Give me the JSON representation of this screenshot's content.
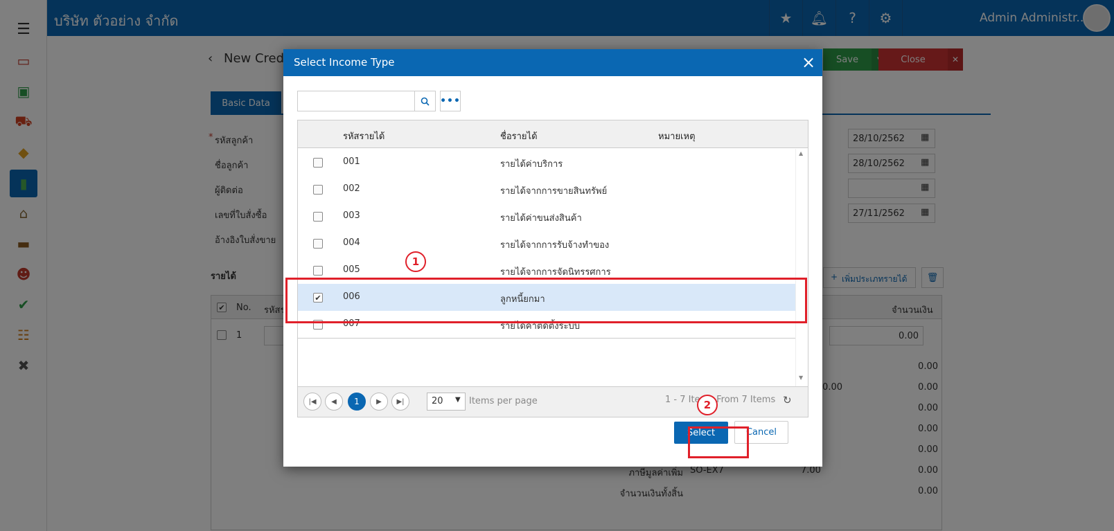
{
  "app": {
    "company_name": "บริษัท ตัวอย่าง จำกัด",
    "admin_name": "Admin Administr...",
    "page_title": "New Cred",
    "save_label": "Save",
    "close_label": "Close",
    "tab_basic": "Basic Data",
    "form_labels": [
      "รหัสลูกค้า",
      "ชื่อลูกค้า",
      "ผู้ติดต่อ",
      "เลขที่ใบสั่งซื้อ",
      "อ้างอิงใบสั่งขาย"
    ],
    "required_mark": "*",
    "dates": [
      "28/10/2562",
      "28/10/2562",
      "",
      "27/11/2562"
    ],
    "income_section": "รายได้",
    "add_income_type": "เพิ่มประเภทรายได้",
    "table_no": "No.",
    "table_code_short": "รหัสร",
    "table_amount": "จำนวนเงิน",
    "row_no": "1",
    "amounts": [
      "0.00",
      "0.00",
      "0.00",
      "0.00",
      "0.00",
      "0.00",
      "0.00"
    ],
    "partial_amount": "0.00",
    "vat_label": "ภาษีมูลค่าเพิ่ม",
    "vat_code": "SO-EX7",
    "vat_rate": "7.00",
    "vat_amount": "0.00",
    "grand_total_label": "จำนวนเงินทั้งสิ้น",
    "grand_total": "0.00"
  },
  "modal": {
    "title": "Select Income Type",
    "search_placeholder": "",
    "columns": {
      "code": "รหัสรายได้",
      "name": "ชื่อรายได้",
      "note": "หมายเหตุ"
    },
    "rows": [
      {
        "code": "001",
        "name": "รายได้ค่าบริการ",
        "checked": false
      },
      {
        "code": "002",
        "name": "รายได้จากการขายสินทรัพย์",
        "checked": false
      },
      {
        "code": "003",
        "name": "รายได้ค่าขนส่งสินค้า",
        "checked": false
      },
      {
        "code": "004",
        "name": "รายได้จากการรับจ้างทำของ",
        "checked": false
      },
      {
        "code": "005",
        "name": "รายได้จากการจัดนิทรรศการ",
        "checked": false
      },
      {
        "code": "006",
        "name": "ลูกหนี้ยกมา",
        "checked": true
      },
      {
        "code": "007",
        "name": "รายได้ค่าติดตั้งระบบ",
        "checked": false
      }
    ],
    "pager": {
      "current_page": "1",
      "page_size": "20",
      "items_per_page_label": "Items per page",
      "items_info": "1 - 7 Items From 7 Items"
    },
    "select_label": "Select",
    "cancel_label": "Cancel"
  },
  "annotations": {
    "marker_1": "1",
    "marker_2": "2"
  },
  "colors": {
    "primary": "#0a67b2",
    "save_green": "#2e9c48",
    "close_red": "#cc3333",
    "highlight_red": "#e0202a",
    "selected_row": "#d9e8f9"
  },
  "icons": {
    "sidebar": [
      "menu-icon",
      "dashboard-icon",
      "money-icon",
      "cart-icon",
      "box-icon",
      "book-icon",
      "bank-icon",
      "wallet-icon",
      "user-icon",
      "check-icon",
      "report-icon",
      "tools-icon"
    ],
    "topbar": [
      "star-icon",
      "bell-icon",
      "help-icon",
      "gear-icon",
      "power-icon"
    ]
  }
}
